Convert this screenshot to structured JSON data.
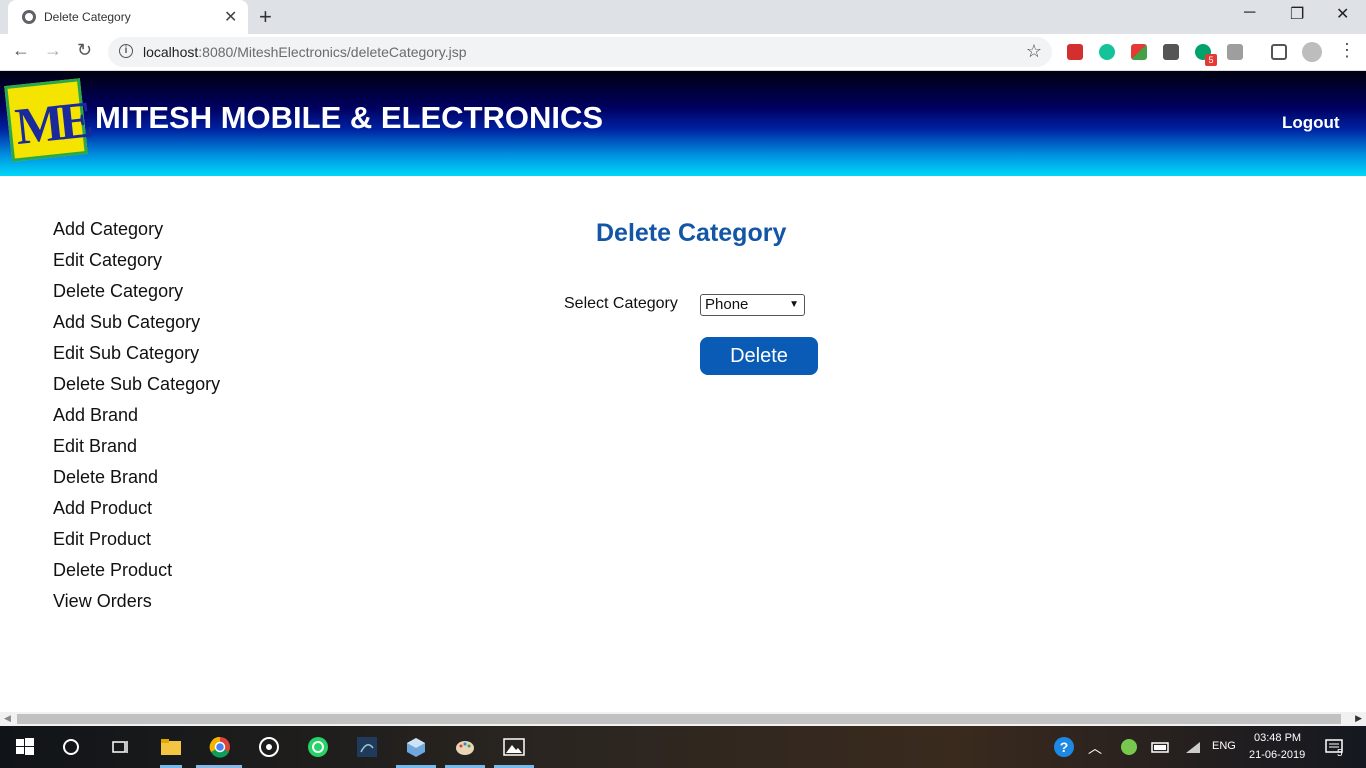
{
  "browser": {
    "tab_title": "Delete Category",
    "tab_close": "✕",
    "new_tab": "+",
    "url_host": "localhost",
    "url_rest": ":8080/MiteshElectronics/deleteCategory.jsp",
    "window_controls": {
      "minimize": "─",
      "restore": "❐",
      "close": "✕"
    },
    "nav": {
      "back": "←",
      "forward": "→",
      "reload": "↻"
    },
    "extension_badge": "5"
  },
  "site": {
    "logo_text": "ME",
    "title": "MITESH MOBILE & ELECTRONICS",
    "logout": "Logout"
  },
  "sidebar": {
    "items": [
      {
        "label": "Add Category"
      },
      {
        "label": "Edit Category"
      },
      {
        "label": "Delete Category"
      },
      {
        "label": "Add Sub Category"
      },
      {
        "label": "Edit Sub Category"
      },
      {
        "label": "Delete Sub Category"
      },
      {
        "label": "Add Brand"
      },
      {
        "label": "Edit Brand"
      },
      {
        "label": "Delete Brand"
      },
      {
        "label": "Add Product"
      },
      {
        "label": "Edit Product"
      },
      {
        "label": "Delete Product"
      },
      {
        "label": "View Orders"
      }
    ]
  },
  "main": {
    "heading": "Delete Category",
    "field_label": "Select Category",
    "selected_category": "Phone",
    "delete_button": "Delete"
  },
  "taskbar": {
    "language": "ENG",
    "time": "03:48 PM",
    "date": "21-06-2019",
    "notification_count": "5"
  },
  "colors": {
    "heading": "#1256a5",
    "button": "#0a5bb5"
  }
}
